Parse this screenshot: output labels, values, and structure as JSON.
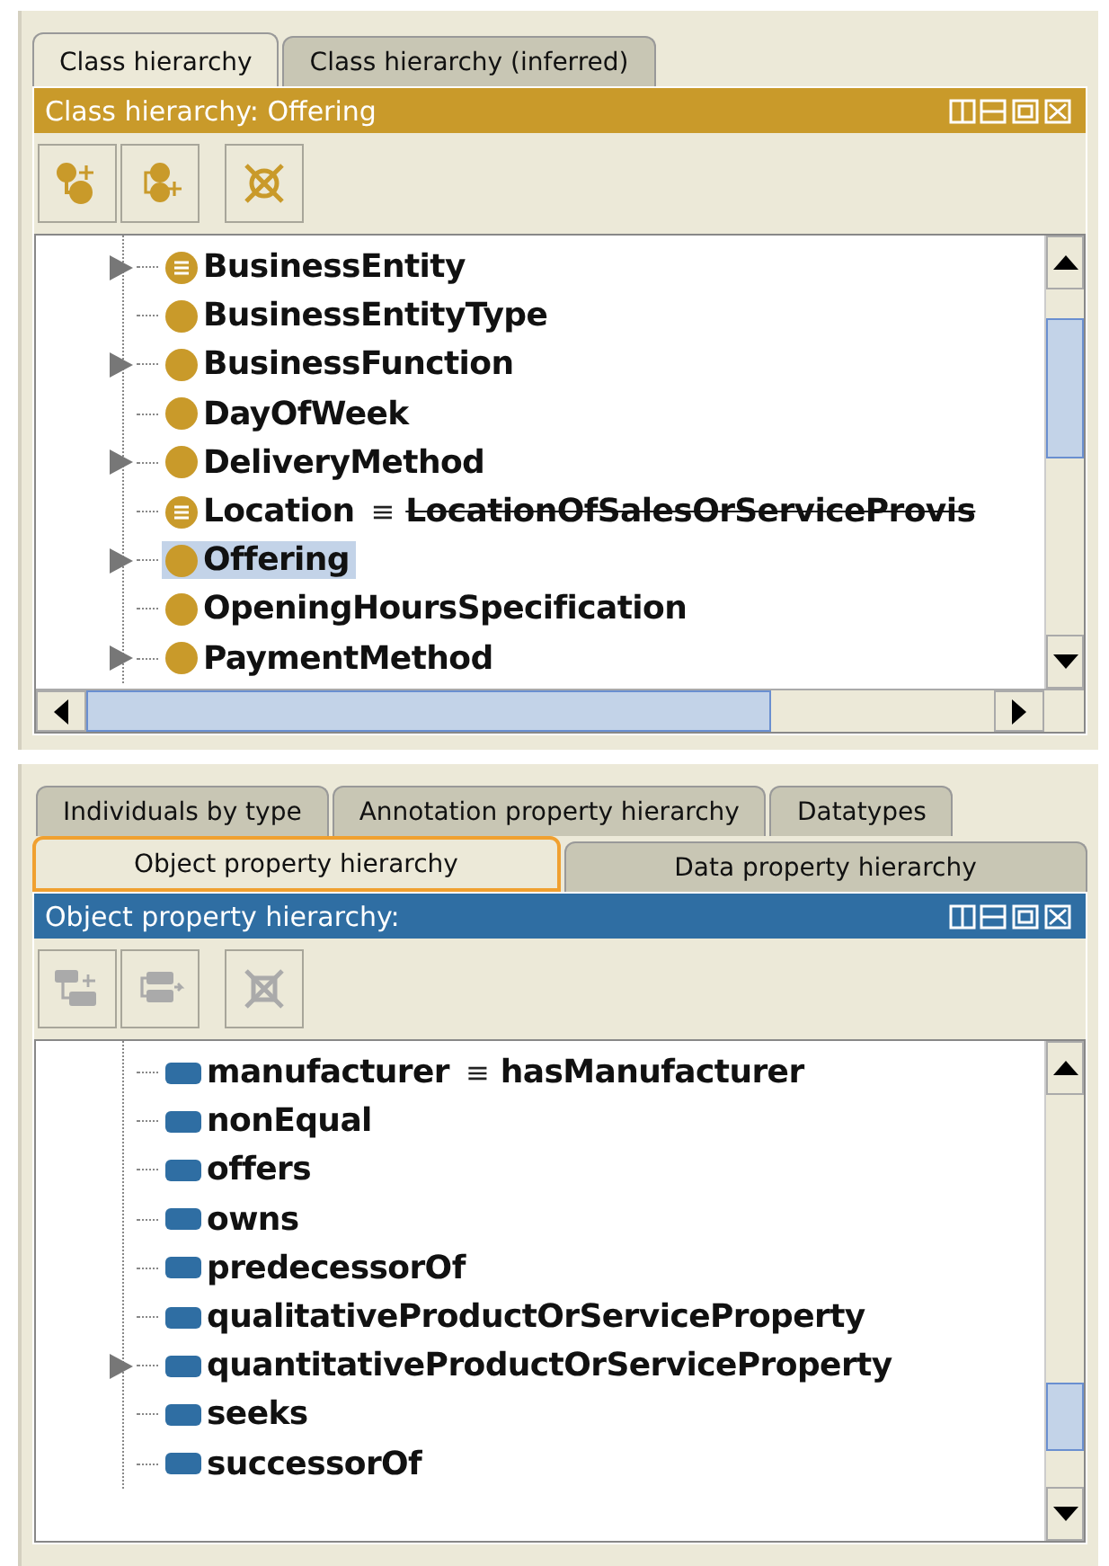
{
  "class_panel": {
    "tabs": [
      {
        "label": "Class hierarchy",
        "selected": true
      },
      {
        "label": "Class hierarchy (inferred)",
        "selected": false
      }
    ],
    "title": "Class hierarchy: Offering",
    "toolbar": [
      {
        "kind": "add-subclass",
        "disabled": false
      },
      {
        "kind": "add-sibling",
        "disabled": false
      },
      {
        "kind": "delete",
        "disabled": false
      }
    ],
    "tree": [
      {
        "label": "BusinessEntity",
        "kind": "defined",
        "expandable": true,
        "selected": false
      },
      {
        "label": "BusinessEntityType",
        "kind": "class",
        "expandable": false,
        "selected": false
      },
      {
        "label": "BusinessFunction",
        "kind": "class",
        "expandable": true,
        "selected": false
      },
      {
        "label": "DayOfWeek",
        "kind": "class",
        "expandable": false,
        "selected": false
      },
      {
        "label": "DeliveryMethod",
        "kind": "class",
        "expandable": true,
        "selected": false
      },
      {
        "label": "Location",
        "kind": "defined",
        "expandable": false,
        "selected": false,
        "equivalent": "≡",
        "equivalent_to": "LocationOfSalesOrServiceProvis",
        "deprecated": true
      },
      {
        "label": "Offering",
        "kind": "class",
        "expandable": true,
        "selected": true
      },
      {
        "label": "OpeningHoursSpecification",
        "kind": "class",
        "expandable": false,
        "selected": false
      },
      {
        "label": "PaymentMethod",
        "kind": "class",
        "expandable": true,
        "selected": false
      }
    ]
  },
  "property_panel": {
    "tab_rows": [
      [
        {
          "label": "Individuals by type",
          "selected": false
        },
        {
          "label": "Annotation property hierarchy",
          "selected": false
        },
        {
          "label": "Datatypes",
          "selected": false
        }
      ],
      [
        {
          "label": "Object property hierarchy",
          "selected": true
        },
        {
          "label": "Data property hierarchy",
          "selected": false
        }
      ]
    ],
    "title": "Object property hierarchy:",
    "toolbar": [
      {
        "kind": "add-subproperty",
        "disabled": true
      },
      {
        "kind": "add-sibling",
        "disabled": true
      },
      {
        "kind": "delete",
        "disabled": true
      }
    ],
    "tree": [
      {
        "label": "manufacturer",
        "kind": "property",
        "expandable": false,
        "selected": false,
        "equivalent": "≡",
        "equivalent_to": "hasManufacturer",
        "deprecated": false
      },
      {
        "label": "nonEqual",
        "kind": "property",
        "expandable": false,
        "selected": false
      },
      {
        "label": "offers",
        "kind": "property",
        "expandable": false,
        "selected": false
      },
      {
        "label": "owns",
        "kind": "property",
        "expandable": false,
        "selected": false
      },
      {
        "label": "predecessorOf",
        "kind": "property",
        "expandable": false,
        "selected": false
      },
      {
        "label": "qualitativeProductOrServiceProperty",
        "kind": "property",
        "expandable": false,
        "selected": false
      },
      {
        "label": "quantitativeProductOrServiceProperty",
        "kind": "property",
        "expandable": true,
        "selected": false
      },
      {
        "label": "seeks",
        "kind": "property",
        "expandable": false,
        "selected": false
      },
      {
        "label": "successorOf",
        "kind": "property",
        "expandable": false,
        "selected": false
      }
    ]
  }
}
